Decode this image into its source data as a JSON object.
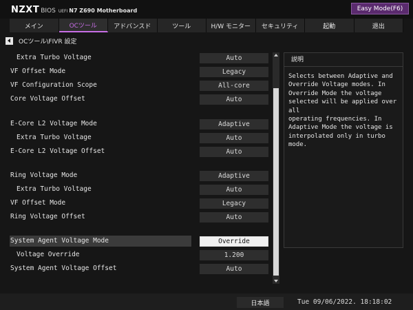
{
  "header": {
    "brand": "NZXT",
    "bios": "BIOS",
    "uefi": "UEFI",
    "model": "N7 Z690 Motherboard",
    "easy_mode": "Easy Mode(F6)"
  },
  "tabs": [
    {
      "label": "メイン"
    },
    {
      "label": "OCツール"
    },
    {
      "label": "アドバンスド"
    },
    {
      "label": "ツール"
    },
    {
      "label": "H/W モニター"
    },
    {
      "label": "セキュリティ"
    },
    {
      "label": "起動"
    },
    {
      "label": "退出"
    }
  ],
  "breadcrumb": "OCツール\\FIVR 設定",
  "settings": [
    {
      "label": "Extra Turbo Voltage",
      "value": "Auto"
    },
    {
      "label": "VF Offset Mode",
      "value": "Legacy"
    },
    {
      "label": "VF Configuration Scope",
      "value": "All-core"
    },
    {
      "label": "Core Voltage Offset",
      "value": "Auto"
    },
    {
      "label": "E-Core L2 Voltage Mode",
      "value": "Adaptive"
    },
    {
      "label": "Extra Turbo Voltage",
      "value": "Auto"
    },
    {
      "label": "E-Core L2 Voltage Offset",
      "value": "Auto"
    },
    {
      "label": "Ring Voltage Mode",
      "value": "Adaptive"
    },
    {
      "label": "Extra Turbo Voltage",
      "value": "Auto"
    },
    {
      "label": "VF Offset Mode",
      "value": "Legacy"
    },
    {
      "label": "Ring Voltage Offset",
      "value": "Auto"
    },
    {
      "label": "System Agent Voltage Mode",
      "value": "Override"
    },
    {
      "label": "Voltage Override",
      "value": "1.200"
    },
    {
      "label": "System Agent Voltage Offset",
      "value": "Auto"
    }
  ],
  "help": {
    "title": "説明",
    "text": "Selects between Adaptive and\nOverride Voltage modes. In\nOverride Mode the voltage\nselected will be applied over all\noperating frequencies. In\nAdaptive Mode the voltage is\ninterpolated only in turbo mode."
  },
  "footer": {
    "language": "日本語",
    "datetime": "Tue 09/06/2022. 18:18:02"
  },
  "colors": {
    "accent": "#c86ee6",
    "easy_mode_bg": "#5a2a6e"
  }
}
